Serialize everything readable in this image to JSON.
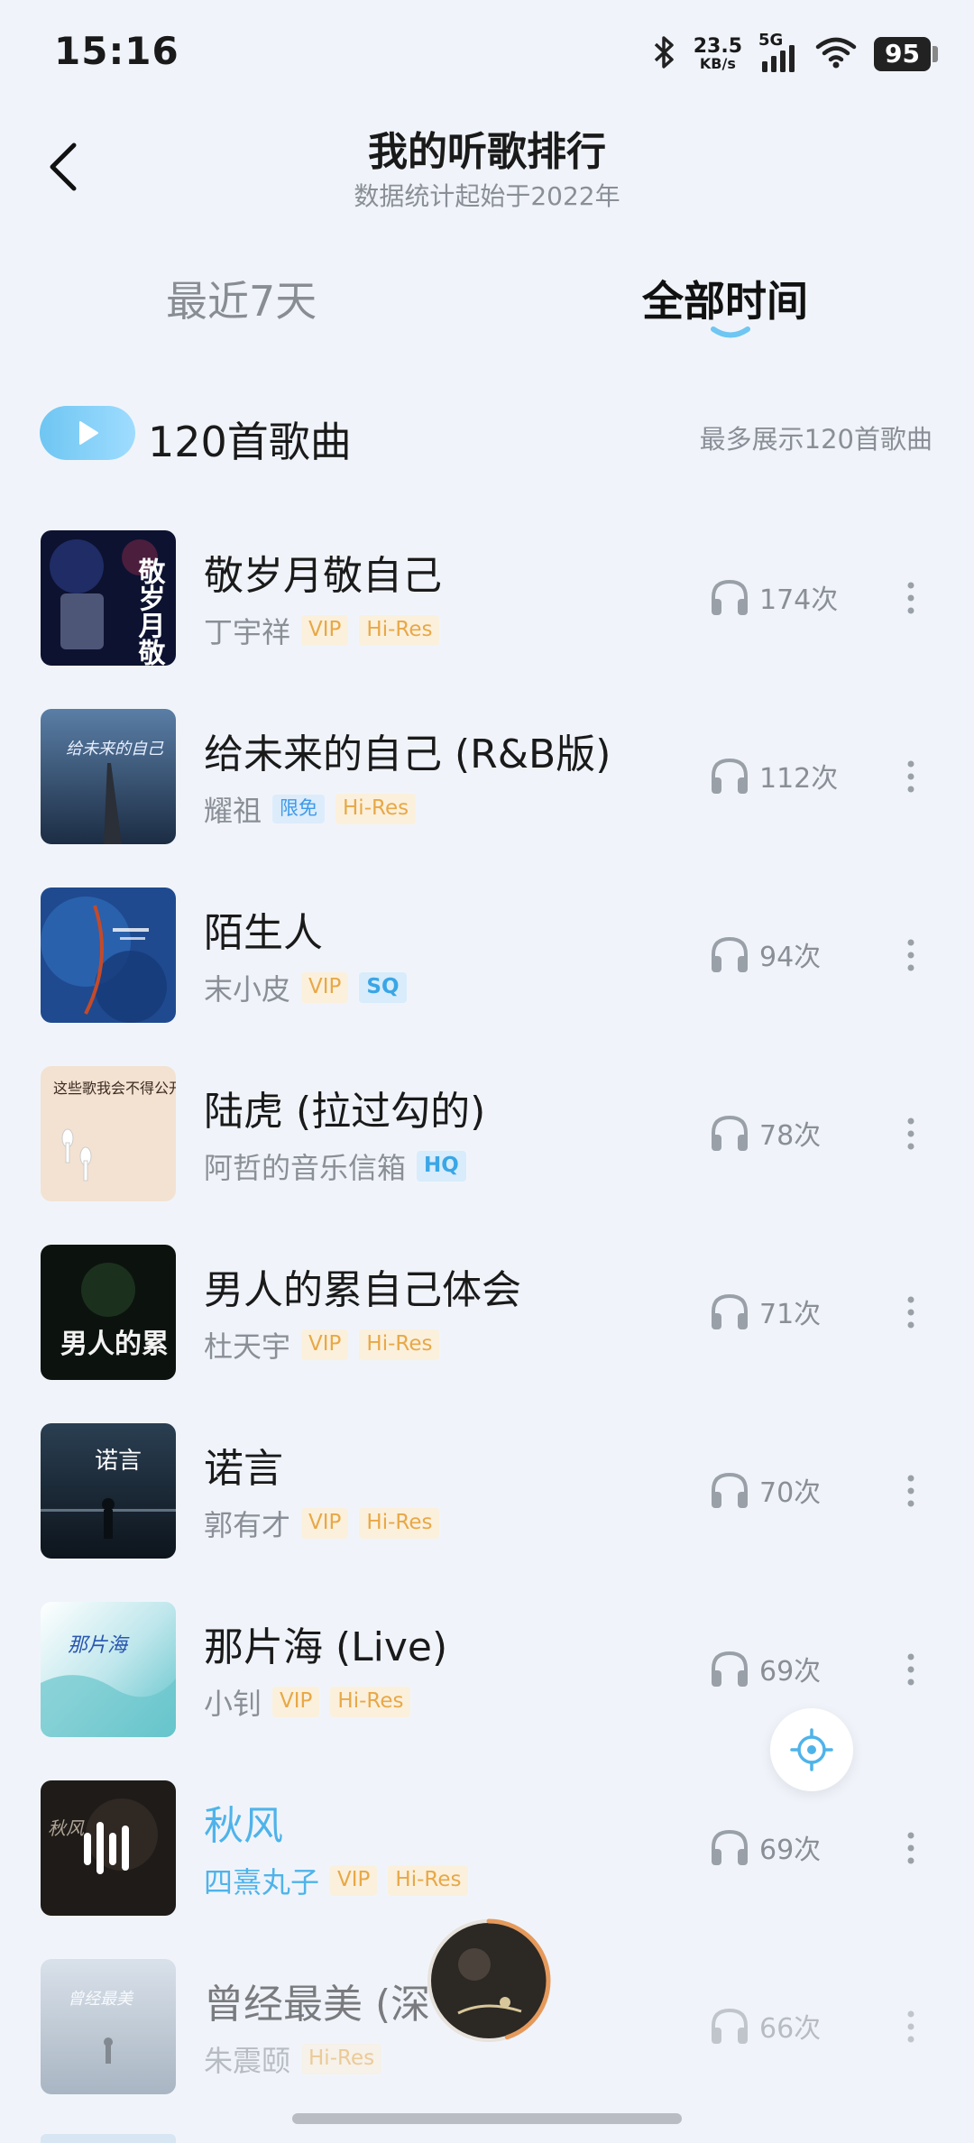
{
  "status_bar": {
    "time": "15:16",
    "net_speed_value": "23.5",
    "net_speed_unit": "KB/s",
    "network_type": "5G",
    "battery": "95",
    "icons": [
      "bluetooth-icon",
      "signal-icon",
      "wifi-icon",
      "battery-icon"
    ]
  },
  "header": {
    "title": "我的听歌排行",
    "subtitle": "数据统计起始于2022年"
  },
  "tabs": [
    {
      "label": "最近7天",
      "selected": false
    },
    {
      "label": "全部时间",
      "selected": true
    }
  ],
  "summary": {
    "count_label": "120首歌曲",
    "note": "最多展示120首歌曲"
  },
  "colors": {
    "accent": "#4fb3ea",
    "background": "#f0f4fa",
    "vip_badge": "#e8a847",
    "play_progress": "#e59a5c"
  },
  "songs": [
    {
      "title": "敬岁月敬自己",
      "artist": "丁宇祥",
      "badges": [
        {
          "text": "VIP",
          "kind": "vip"
        },
        {
          "text": "Hi-Res",
          "kind": "hires"
        }
      ],
      "plays": "174次",
      "cover_text": "敬岁月敬自己"
    },
    {
      "title": "给未来的自己 (R&B版)",
      "artist": "耀祖",
      "badges": [
        {
          "text": "限免",
          "kind": "free"
        },
        {
          "text": "Hi-Res",
          "kind": "hires"
        }
      ],
      "plays": "112次",
      "cover_text": "给未来的自己"
    },
    {
      "title": "陌生人",
      "artist": "末小皮",
      "badges": [
        {
          "text": "VIP",
          "kind": "vip"
        },
        {
          "text": "SQ",
          "kind": "sq"
        }
      ],
      "plays": "94次"
    },
    {
      "title": "陆虎 (拉过勾的)",
      "artist": "阿哲的音乐信箱",
      "badges": [
        {
          "text": "HQ",
          "kind": "hq"
        }
      ],
      "plays": "78次",
      "cover_text": "这些歌我会不得公开"
    },
    {
      "title": "男人的累自己体会",
      "artist": "杜天宇",
      "badges": [
        {
          "text": "VIP",
          "kind": "vip"
        },
        {
          "text": "Hi-Res",
          "kind": "hires"
        }
      ],
      "plays": "71次",
      "cover_text": "男人的累"
    },
    {
      "title": "诺言",
      "artist": "郭有才",
      "badges": [
        {
          "text": "VIP",
          "kind": "vip"
        },
        {
          "text": "Hi-Res",
          "kind": "hires"
        }
      ],
      "plays": "70次",
      "cover_text": "诺言"
    },
    {
      "title": "那片海 (Live)",
      "artist": "小钊",
      "badges": [
        {
          "text": "VIP",
          "kind": "vip"
        },
        {
          "text": "Hi-Res",
          "kind": "hires"
        }
      ],
      "plays": "69次",
      "cover_text": "那片海"
    },
    {
      "title": "秋风",
      "artist": "四熹丸子",
      "badges": [
        {
          "text": "VIP",
          "kind": "vip"
        },
        {
          "text": "Hi-Res",
          "kind": "hires"
        }
      ],
      "plays": "69次",
      "playing": true,
      "cover_text": "秋风"
    },
    {
      "title": "曾经最美 (深",
      "artist": "朱震颐",
      "badges": [
        {
          "text": "Hi-Res",
          "kind": "hires"
        }
      ],
      "plays": "66次",
      "cover_text": "曾经最美"
    }
  ],
  "mini_player": {
    "progress": 0.45
  }
}
